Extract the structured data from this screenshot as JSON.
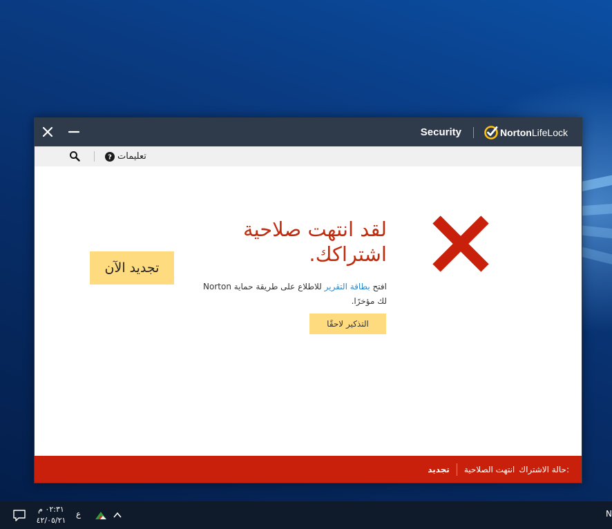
{
  "window": {
    "product_name": "Security",
    "brand_main": "Norton",
    "brand_light": "LifeLock"
  },
  "toolbar": {
    "help_label": "تعليمات"
  },
  "main": {
    "headline": "لقد انتهت صلاحية اشتراكك.",
    "renew_now_label": "تجديد الآن",
    "info_prefix": "افتح ",
    "info_link": "بطاقة التقرير",
    "info_suffix": " للاطلاع على طريقة حماية Norton لك مؤخرًا.",
    "remind_later_label": "التذكير لاحقًا"
  },
  "statusbar": {
    "label": "حالة الاشتراك:",
    "value": "انتهت الصلاحية",
    "renew_label": "تجديد"
  },
  "taskbar": {
    "time": "٠٢:٣١ م",
    "date": "٤٢/٠٥/٢١",
    "language": "ع",
    "edge_text": "N"
  },
  "colors": {
    "title_bar": "#2f3b4a",
    "accent_red": "#c8200a",
    "headline_red": "#bf2d0e",
    "button_yellow": "#ffdb80",
    "brand_yellow": "#ffc20e",
    "link_blue": "#2f88c7"
  },
  "icons": [
    "close-icon",
    "minimize-icon",
    "norton-check-icon",
    "search-icon",
    "help-icon",
    "error-x-icon",
    "notification-icon",
    "tray-app-icon",
    "chevron-up-icon"
  ]
}
